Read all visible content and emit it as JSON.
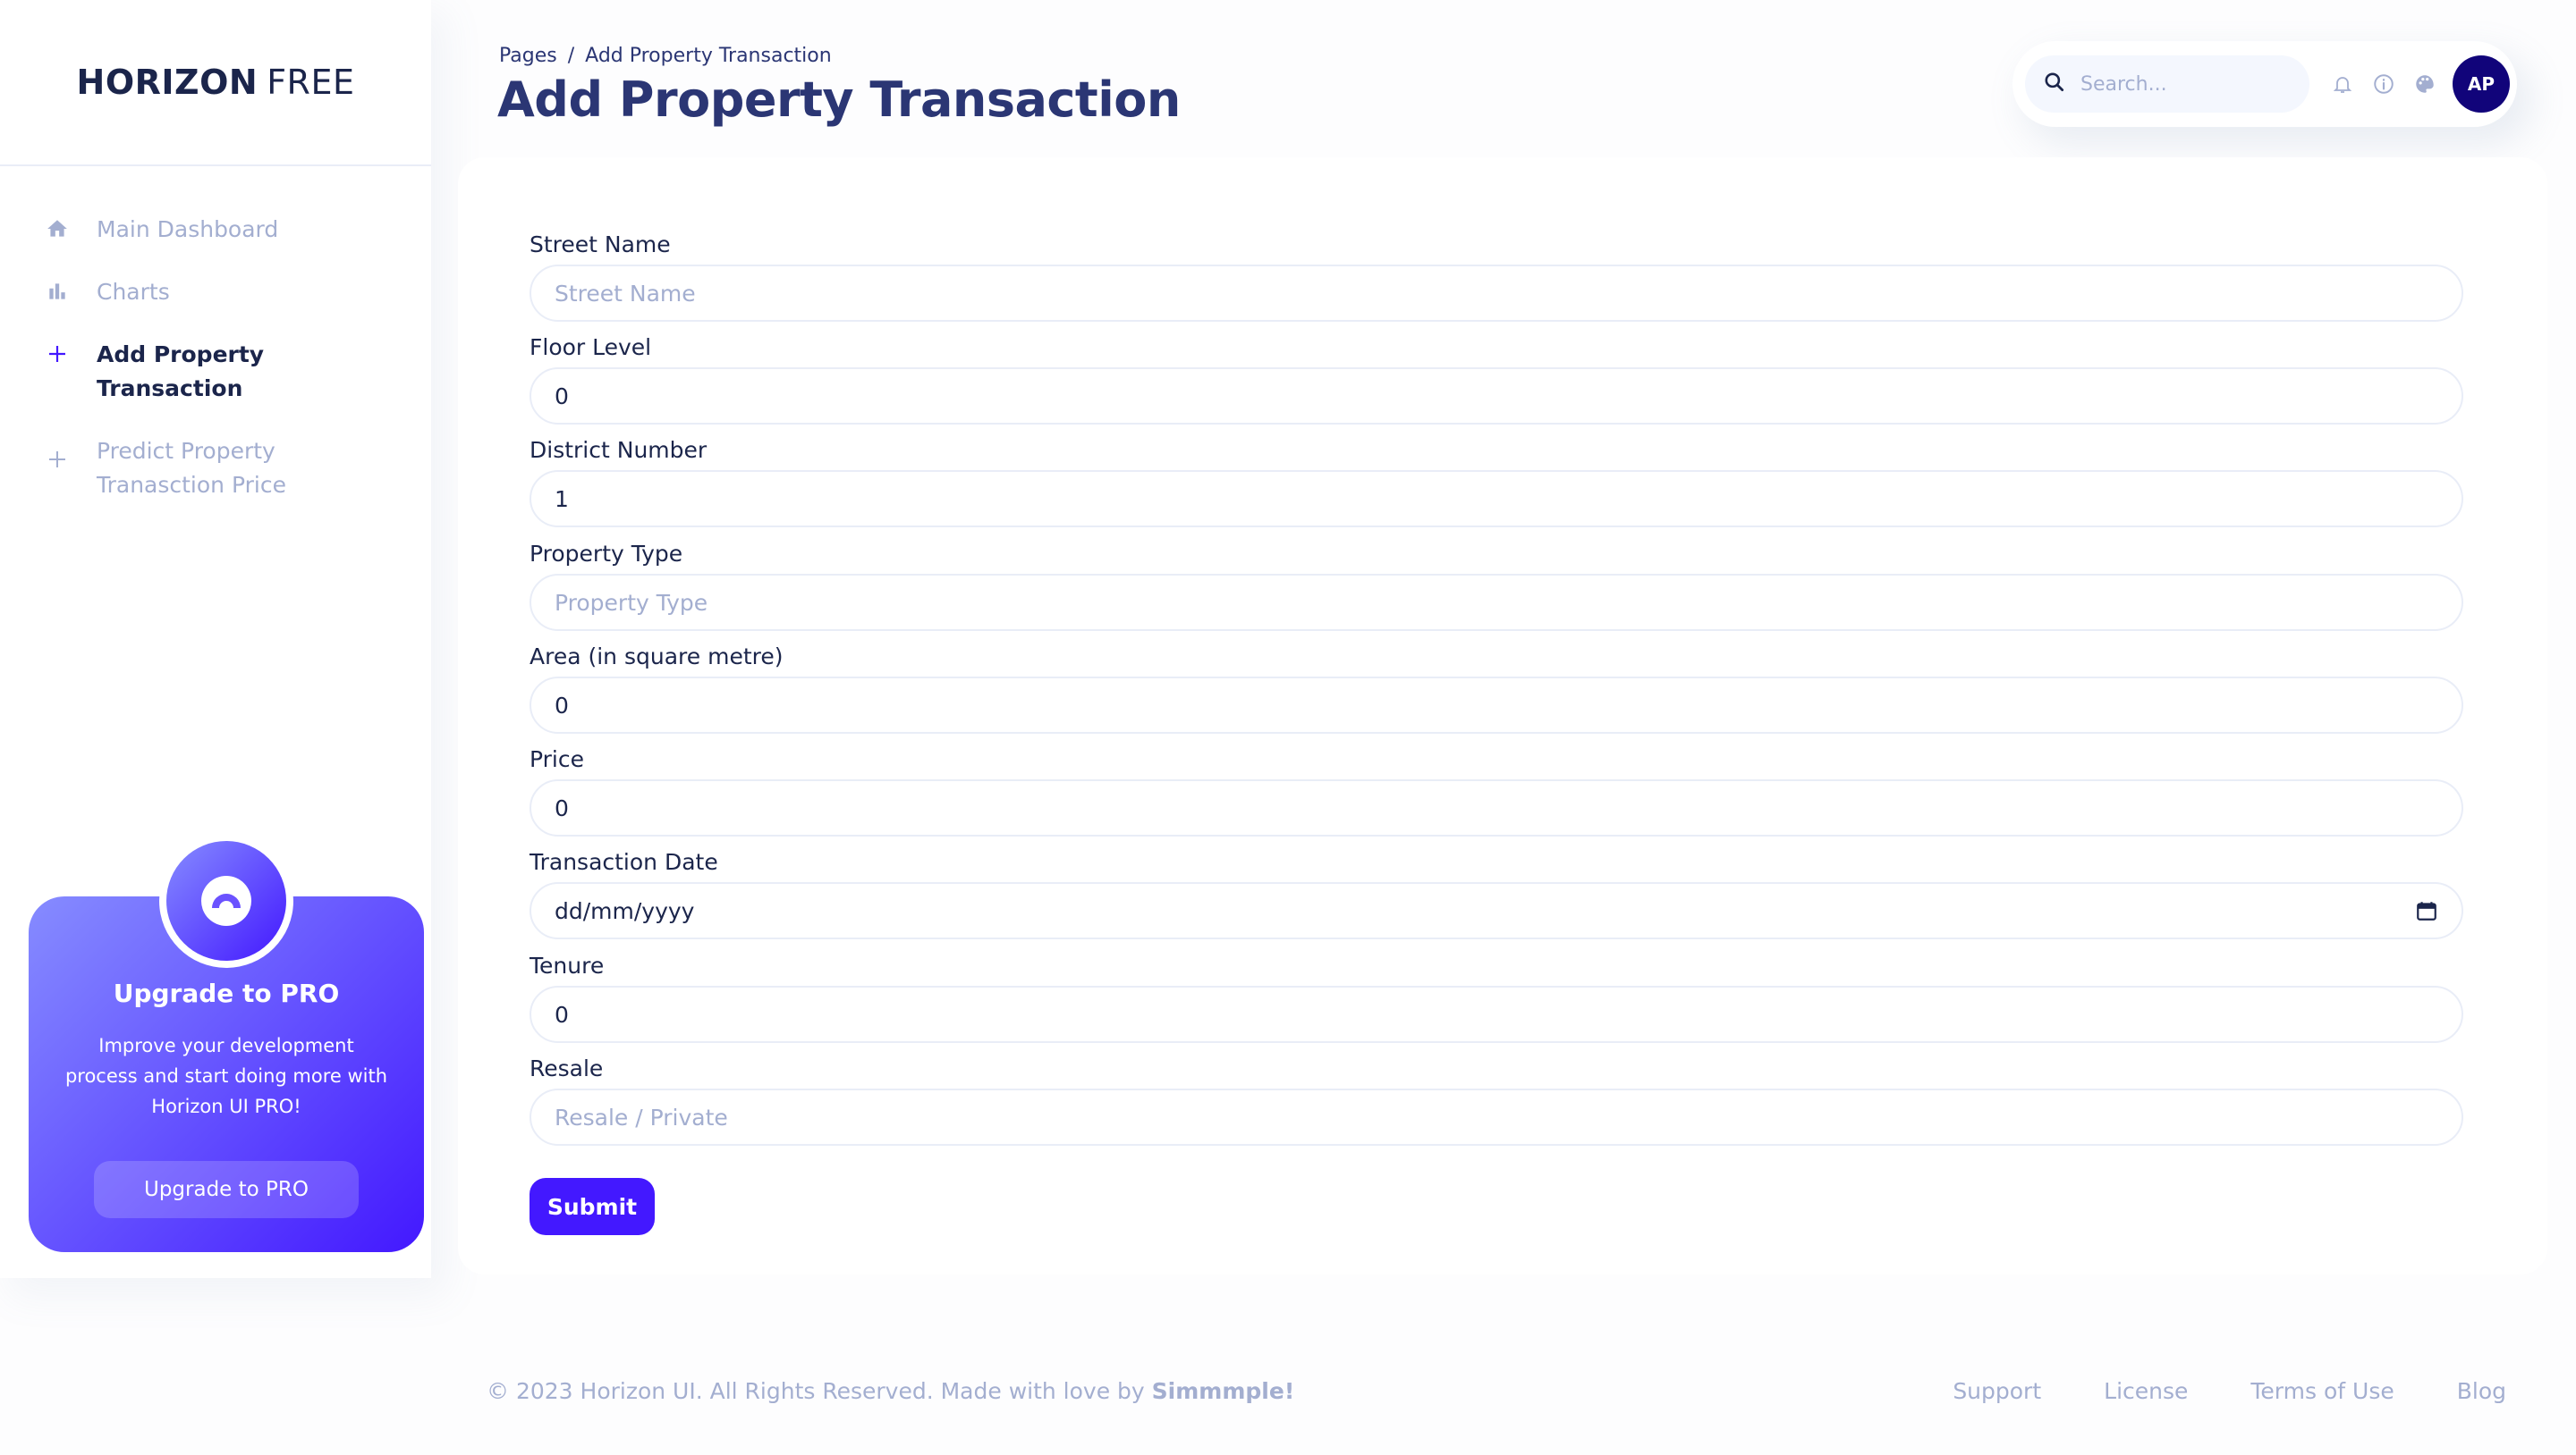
{
  "sidebar": {
    "brand_bold": "HORIZON",
    "brand_light": "FREE",
    "items": [
      {
        "label": "Main Dashboard",
        "icon": "home-icon"
      },
      {
        "label": "Charts",
        "icon": "bar-chart-icon"
      },
      {
        "label": "Add Property Transaction",
        "icon": "plus-icon",
        "active": true
      },
      {
        "label": "Predict Property Tranasction Price",
        "icon": "plus-icon"
      }
    ],
    "promo": {
      "title": "Upgrade to PRO",
      "text": "Improve your development process and start doing more with Horizon UI PRO!",
      "button": "Upgrade to PRO"
    }
  },
  "header": {
    "breadcrumb_root": "Pages",
    "breadcrumb_sep": "/",
    "breadcrumb_current": "Add Property Transaction",
    "title": "Add Property Transaction",
    "search_placeholder": "Search...",
    "avatar_initials": "AP"
  },
  "form": {
    "fields": [
      {
        "label": "Street Name",
        "value": "",
        "placeholder": "Street Name"
      },
      {
        "label": "Floor Level",
        "value": "0",
        "placeholder": ""
      },
      {
        "label": "District Number",
        "value": "1",
        "placeholder": ""
      },
      {
        "label": "Property Type",
        "value": "",
        "placeholder": "Property Type"
      },
      {
        "label": "Area (in square metre)",
        "value": "0",
        "placeholder": ""
      },
      {
        "label": "Price",
        "value": "0",
        "placeholder": ""
      },
      {
        "label": "Transaction Date",
        "value": "dd/mm/yyyy",
        "placeholder": ""
      },
      {
        "label": "Tenure",
        "value": "0",
        "placeholder": ""
      },
      {
        "label": "Resale",
        "value": "",
        "placeholder": "Resale / Private"
      }
    ],
    "submit": "Submit"
  },
  "footer": {
    "copyright": "© 2023 Horizon UI. All Rights Reserved. Made with love by",
    "author": "Simmmple!",
    "links": [
      "Support",
      "License",
      "Terms of Use",
      "Blog"
    ]
  },
  "colors": {
    "brand": "#4318ff",
    "navy": "#1b254b",
    "muted": "#a3aed0",
    "avatar_bg": "#11047a"
  }
}
